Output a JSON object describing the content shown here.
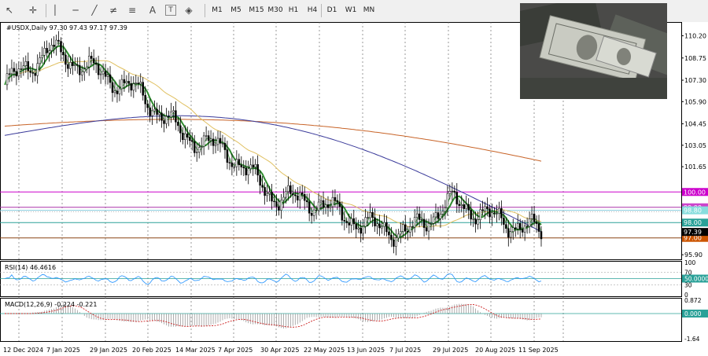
{
  "toolbar": {
    "icons": [
      "crosshair-icon",
      "vertical-line-icon",
      "horizontal-line-icon",
      "trendline-icon",
      "equidistant-channel-icon",
      "fibonacci-icon",
      "text-icon",
      "label-icon",
      "shapes-icon"
    ],
    "timeframes": [
      "M1",
      "M5",
      "M15",
      "M30",
      "H1",
      "H4",
      "D1",
      "W1",
      "MN"
    ]
  },
  "chart": {
    "header": "#USDX,Daily  97.30 97.43 97.17 97.39",
    "price_levels": [
      {
        "label": "110.20",
        "value": 110.2
      },
      {
        "label": "108.75",
        "value": 108.75
      },
      {
        "label": "107.30",
        "value": 107.3
      },
      {
        "label": "105.90",
        "value": 105.9
      },
      {
        "label": "104.45",
        "value": 104.45
      },
      {
        "label": "103.05",
        "value": 103.05
      },
      {
        "label": "101.65",
        "value": 101.65
      },
      {
        "label": "95.90",
        "value": 95.9
      }
    ],
    "horizontal_lines": [
      {
        "label": "100.00",
        "value": 100.0,
        "color": "#cc00cc",
        "label_bg": "#cc00cc"
      },
      {
        "label": "99.00",
        "value": 99.0,
        "color": "#aa33aa",
        "label_bg": "#cc44cc"
      },
      {
        "label": "98.80",
        "value": 98.8,
        "color": "#88ccdd",
        "label_bg": "#88dddd"
      },
      {
        "label": "98.00",
        "value": 98.0,
        "color": "#2aa198",
        "label_bg": "#2aa198"
      },
      {
        "label": "97.00",
        "value": 97.0,
        "color": "#8b4513",
        "label_bg": "#cc5500"
      }
    ],
    "current_price": {
      "label": "97.39",
      "value": 97.39
    },
    "date_labels": [
      "12 Dec 2024",
      "7 Jan 2025",
      "29 Jan 2025",
      "20 Feb 2025",
      "14 Mar 2025",
      "7 Apr 2025",
      "30 Apr 2025",
      "22 May 2025",
      "13 Jun 2025",
      "7 Jul 2025",
      "29 Jul 2025",
      "20 Aug 2025",
      "11 Sep 2025"
    ],
    "series": [
      {
        "name": "price",
        "color": "#000000"
      },
      {
        "name": "ma-fast",
        "color": "#2e8b2e"
      },
      {
        "name": "ma-yellow",
        "color": "#e0c060"
      },
      {
        "name": "ma-blue",
        "color": "#3a3a9a"
      },
      {
        "name": "ma-orange",
        "color": "#c86428"
      }
    ]
  },
  "rsi": {
    "header": "RSI(14) 46.4616",
    "levels": [
      {
        "label": "100",
        "value": 100
      },
      {
        "label": "70",
        "value": 70
      },
      {
        "label": "50.0000",
        "value": 50
      },
      {
        "label": "30",
        "value": 30
      },
      {
        "label": "0",
        "value": 0
      }
    ],
    "color": "#1e90ff"
  },
  "macd": {
    "header": "MACD(12,26,9) -0.224 -0.221",
    "levels": [
      {
        "label": "0.872",
        "value": 0.872
      },
      {
        "label": "0.000",
        "value": 0
      },
      {
        "label": "-1.64",
        "value": -1.64
      }
    ],
    "histogram_color": "#9a9a9a",
    "signal_color": "#cc2222"
  },
  "chart_data": {
    "type": "line",
    "title": "#USDX,Daily",
    "x": [
      "12 Dec 2024",
      "7 Jan 2025",
      "29 Jan 2025",
      "20 Feb 2025",
      "14 Mar 2025",
      "7 Apr 2025",
      "30 Apr 2025",
      "22 May 2025",
      "13 Jun 2025",
      "7 Jul 2025",
      "29 Jul 2025",
      "20 Aug 2025",
      "11 Sep 2025"
    ],
    "series": [
      {
        "name": "#USDX",
        "values": [
          107.0,
          109.3,
          107.9,
          106.5,
          103.7,
          102.6,
          99.7,
          99.3,
          97.9,
          97.3,
          99.4,
          98.2,
          97.4
        ]
      }
    ],
    "ylim": [
      95.5,
      111.0
    ]
  }
}
